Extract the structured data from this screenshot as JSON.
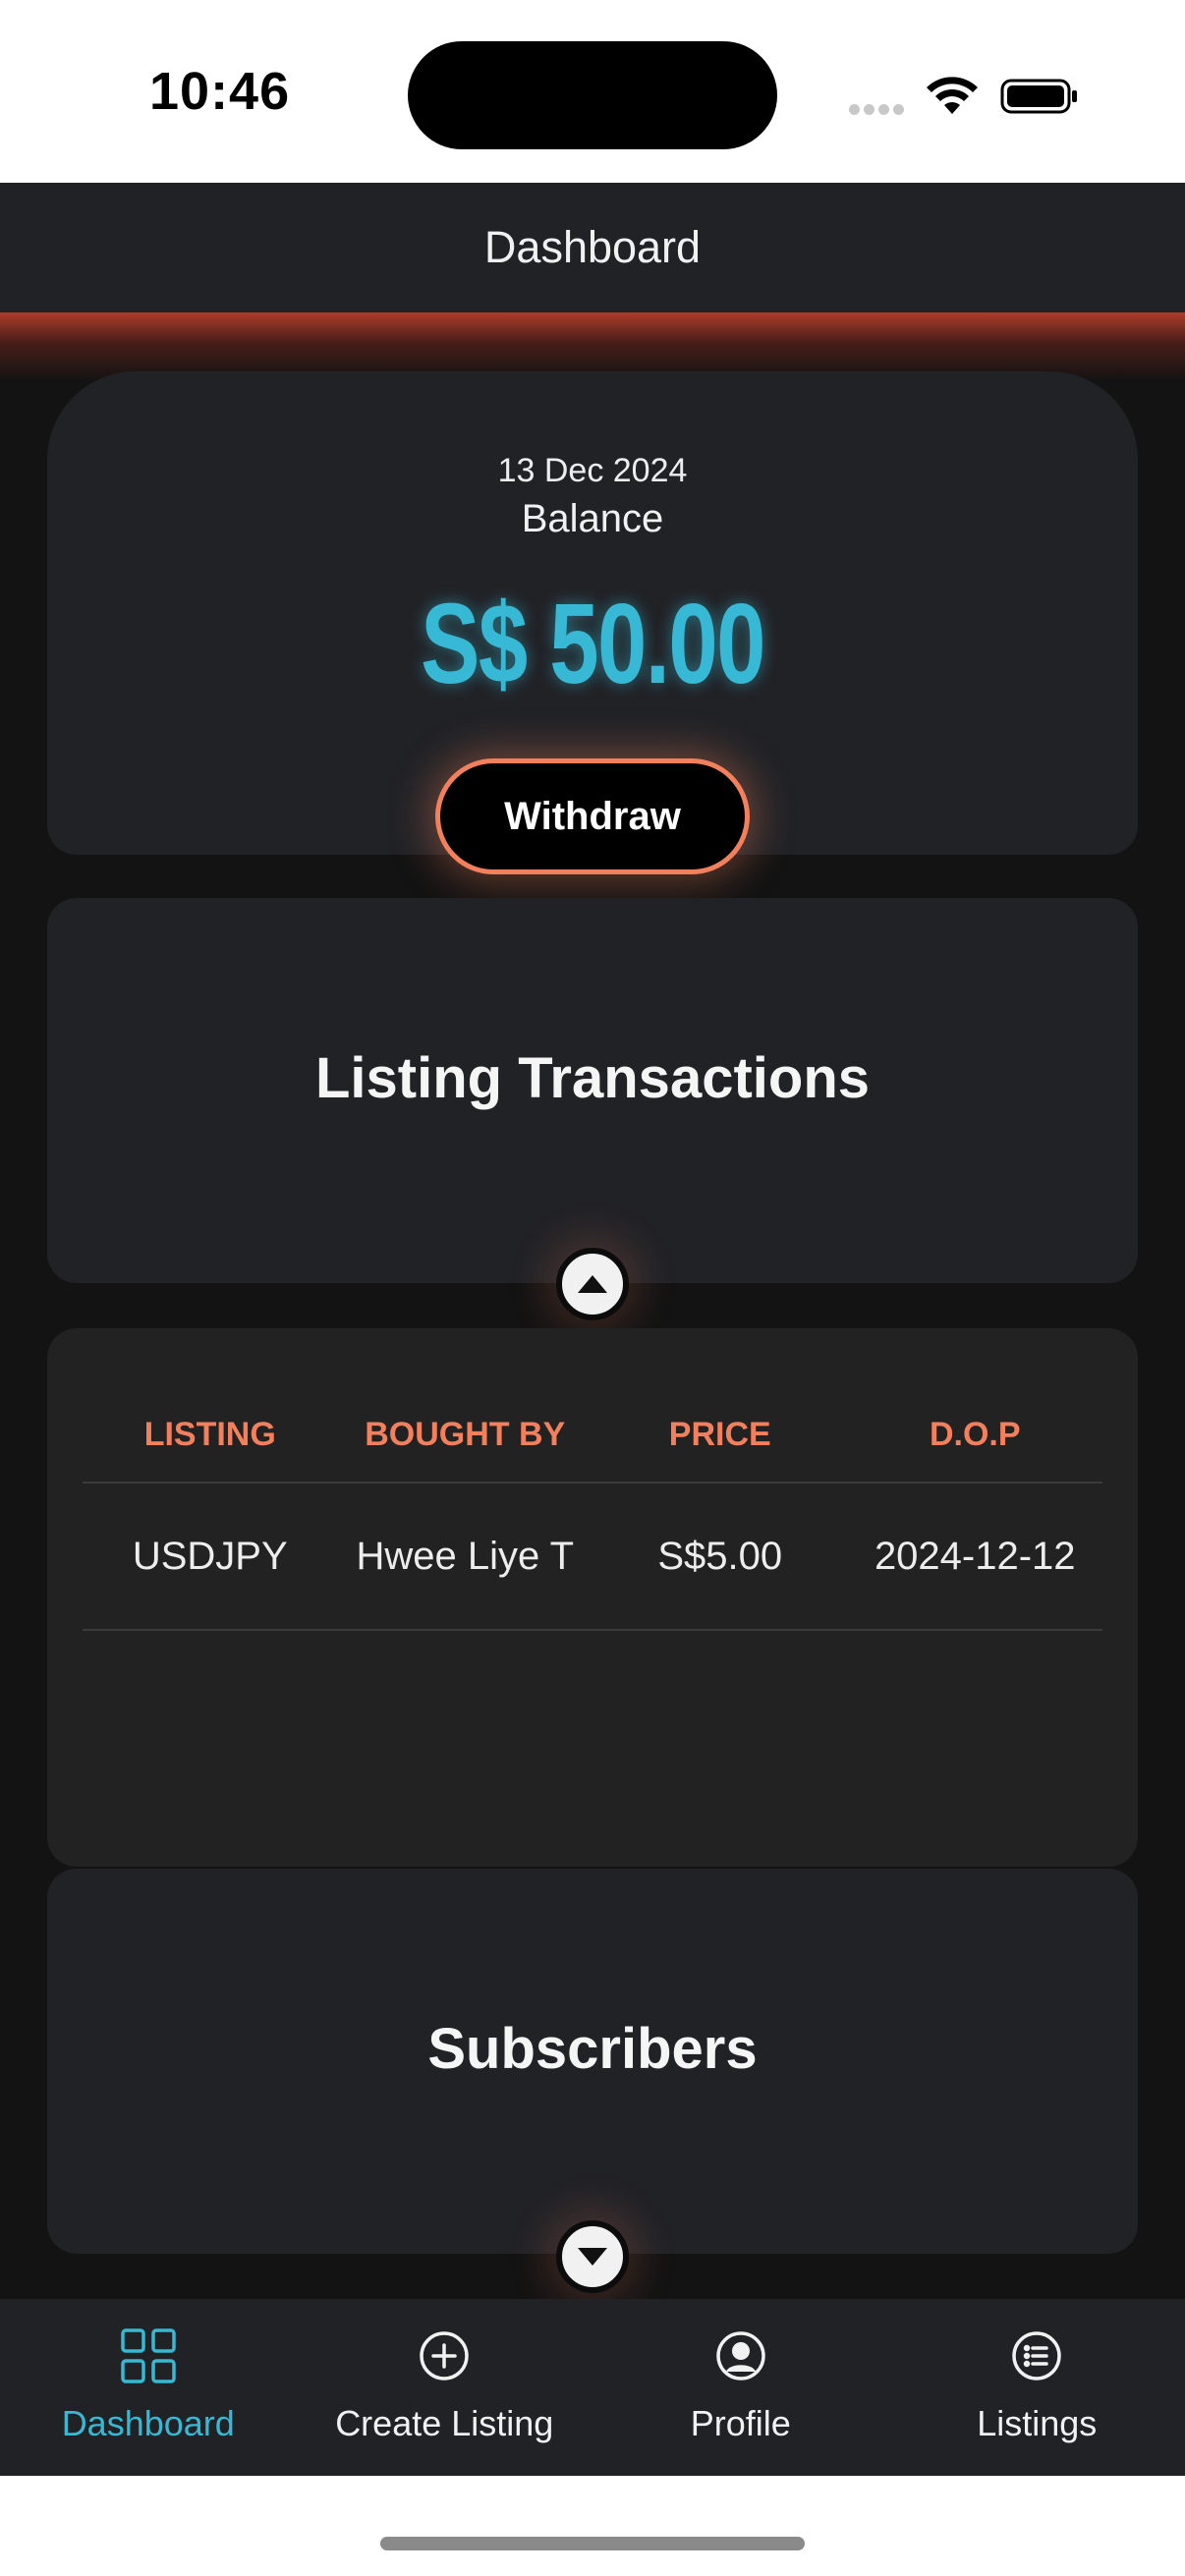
{
  "status": {
    "time": "10:46"
  },
  "header": {
    "title": "Dashboard"
  },
  "balance": {
    "date": "13 Dec 2024",
    "label": "Balance",
    "amount": "S$ 50.00",
    "withdraw_label": "Withdraw"
  },
  "transactions": {
    "title": "Listing Transactions",
    "columns": [
      "LISTING",
      "BOUGHT BY",
      "PRICE",
      "D.O.P"
    ],
    "rows": [
      [
        "USDJPY",
        "Hwee Liye T",
        "S$5.00",
        "2024-12-12"
      ]
    ]
  },
  "subscribers": {
    "title": "Subscribers"
  },
  "tabs": [
    {
      "label": "Dashboard",
      "icon": "grid-icon",
      "active": true
    },
    {
      "label": "Create Listing",
      "icon": "plus-circle-icon",
      "active": false
    },
    {
      "label": "Profile",
      "icon": "user-circle-icon",
      "active": false
    },
    {
      "label": "Listings",
      "icon": "list-circle-icon",
      "active": false
    }
  ],
  "colors": {
    "accent": "#37b8d4",
    "orange": "#f3805d",
    "background": "#131313",
    "card": "#212226"
  }
}
